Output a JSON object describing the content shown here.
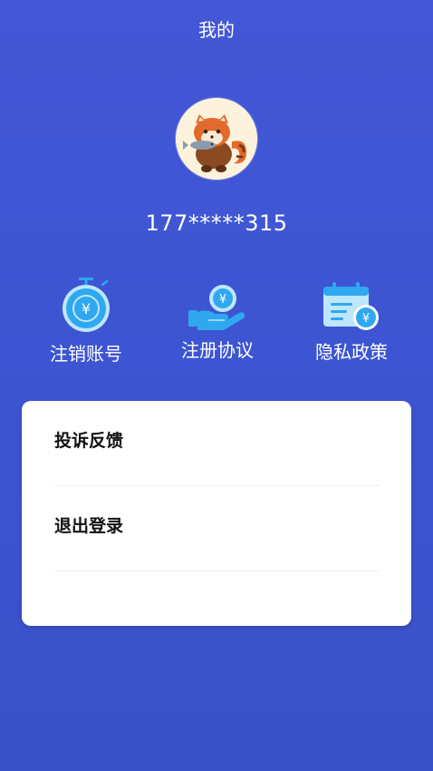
{
  "header": {
    "title": "我的"
  },
  "profile": {
    "phone": "177*****315",
    "avatar_icon": "red-panda-avatar"
  },
  "actions": [
    {
      "label": "注销账号",
      "icon": "stopwatch-yen-icon"
    },
    {
      "label": "注册协议",
      "icon": "hand-coin-yen-icon"
    },
    {
      "label": "隐私政策",
      "icon": "calendar-yen-icon"
    }
  ],
  "menu": [
    {
      "label": "投诉反馈"
    },
    {
      "label": "退出登录"
    }
  ],
  "colors": {
    "background": "#3f55d3",
    "icon_blue": "#2fa8f0",
    "icon_light": "#bfe6ff",
    "card": "#ffffff"
  }
}
